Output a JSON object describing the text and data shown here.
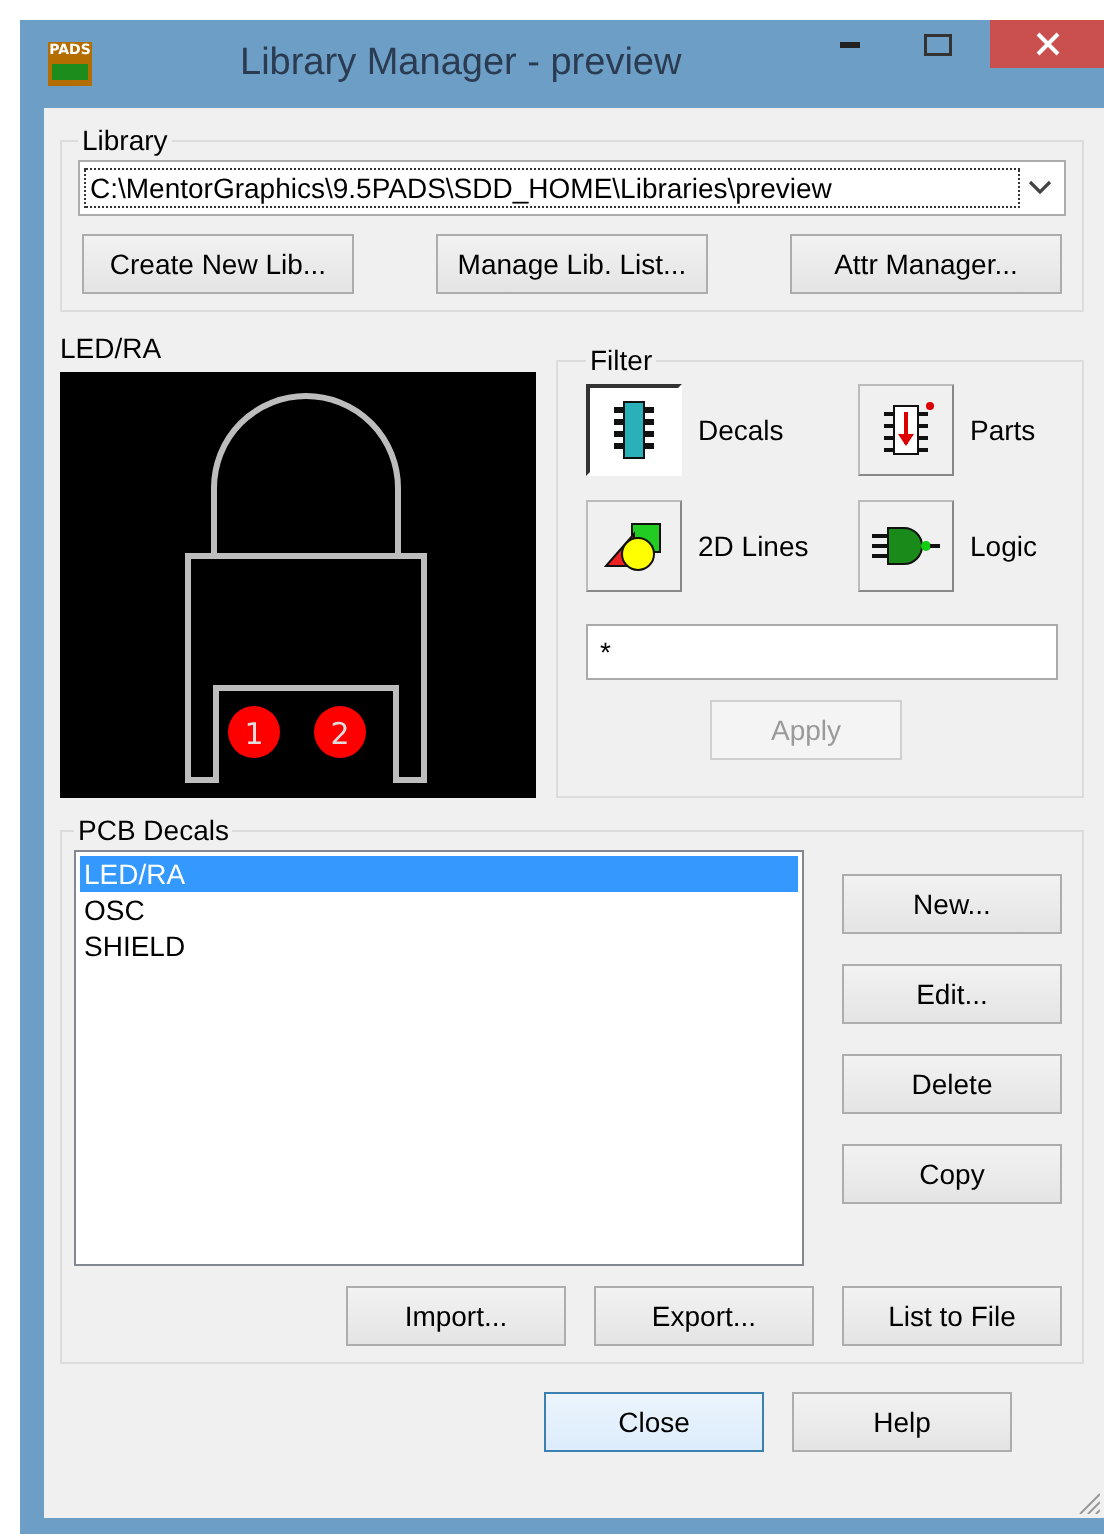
{
  "window": {
    "title": "Library Manager - preview",
    "app_icon_text": "PADS"
  },
  "library": {
    "label": "Library",
    "path": "C:\\MentorGraphics\\9.5PADS\\SDD_HOME\\Libraries\\preview",
    "buttons": [
      "Create New Lib...",
      "Manage Lib. List...",
      "Attr Manager..."
    ]
  },
  "preview": {
    "title": "LED/RA",
    "pins": [
      "1",
      "2"
    ]
  },
  "filter": {
    "label": "Filter",
    "buttons": [
      {
        "label": "Decals",
        "kind": "decals",
        "selected": true
      },
      {
        "label": "Parts",
        "kind": "parts",
        "selected": false
      },
      {
        "label": "2D Lines",
        "kind": "lines",
        "selected": false
      },
      {
        "label": "Logic",
        "kind": "logic",
        "selected": false
      }
    ],
    "value": "*",
    "apply": {
      "label": "Apply",
      "disabled": true
    }
  },
  "decals": {
    "label": "PCB Decals",
    "items": [
      {
        "name": "LED/RA",
        "selected": true
      },
      {
        "name": "OSC",
        "selected": false
      },
      {
        "name": "SHIELD",
        "selected": false
      }
    ],
    "side_buttons": [
      "New...",
      "Edit...",
      "Delete",
      "Copy"
    ],
    "bottom_buttons": [
      "Import...",
      "Export...",
      "List to File"
    ]
  },
  "footer_buttons": [
    {
      "label": "Close",
      "default": true
    },
    {
      "label": "Help",
      "default": false
    }
  ]
}
